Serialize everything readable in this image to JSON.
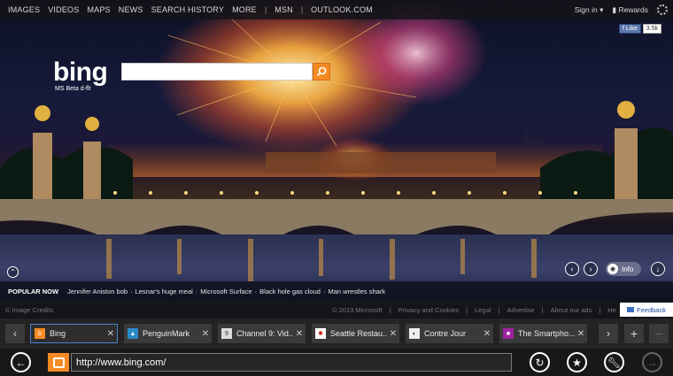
{
  "topnav": {
    "items": [
      "IMAGES",
      "VIDEOS",
      "MAPS",
      "NEWS",
      "SEARCH HISTORY",
      "MORE"
    ],
    "sep": "|",
    "msn": "MSN",
    "outlook": "OUTLOOK.COM",
    "signin": "Sign in",
    "rewards": "Rewards"
  },
  "facebook": {
    "like": "Like",
    "count": "3.5k"
  },
  "brand": {
    "logo": "bing",
    "subtitle": "MS Beta d-flt"
  },
  "search": {
    "value": "",
    "placeholder": ""
  },
  "hero_controls": {
    "info_label": "Info"
  },
  "popular_now": {
    "label": "POPULAR NOW",
    "items": [
      "Jennifer Aniston bob",
      "Lesnar's huge meal",
      "Microsoft Surface",
      "Black hole gas cloud",
      "Man wrestles shark"
    ]
  },
  "footer": {
    "credits": "© Image Credits",
    "links": [
      "© 2013 Microsoft",
      "Privacy and Cookies",
      "Legal",
      "Advertise",
      "About our ads",
      "He"
    ],
    "feedback": "Feedback"
  },
  "tabs": [
    {
      "title": "Bing",
      "active": true
    },
    {
      "title": "PenguinMark",
      "active": false
    },
    {
      "title": "Channel 9: Vid...",
      "active": false
    },
    {
      "title": "Seattle Restau...",
      "active": false
    },
    {
      "title": "Contre Jour",
      "active": false
    },
    {
      "title": "The Smartpho...",
      "active": false
    }
  ],
  "tab_controls": {
    "prev": "‹",
    "next": "›",
    "new": "+",
    "more": "···"
  },
  "address_bar": {
    "url": "http://www.bing.com/"
  },
  "colors": {
    "accent": "#f58a24",
    "active_tab_border": "#4a7fd4",
    "feedback_text": "#1a4c9a"
  }
}
